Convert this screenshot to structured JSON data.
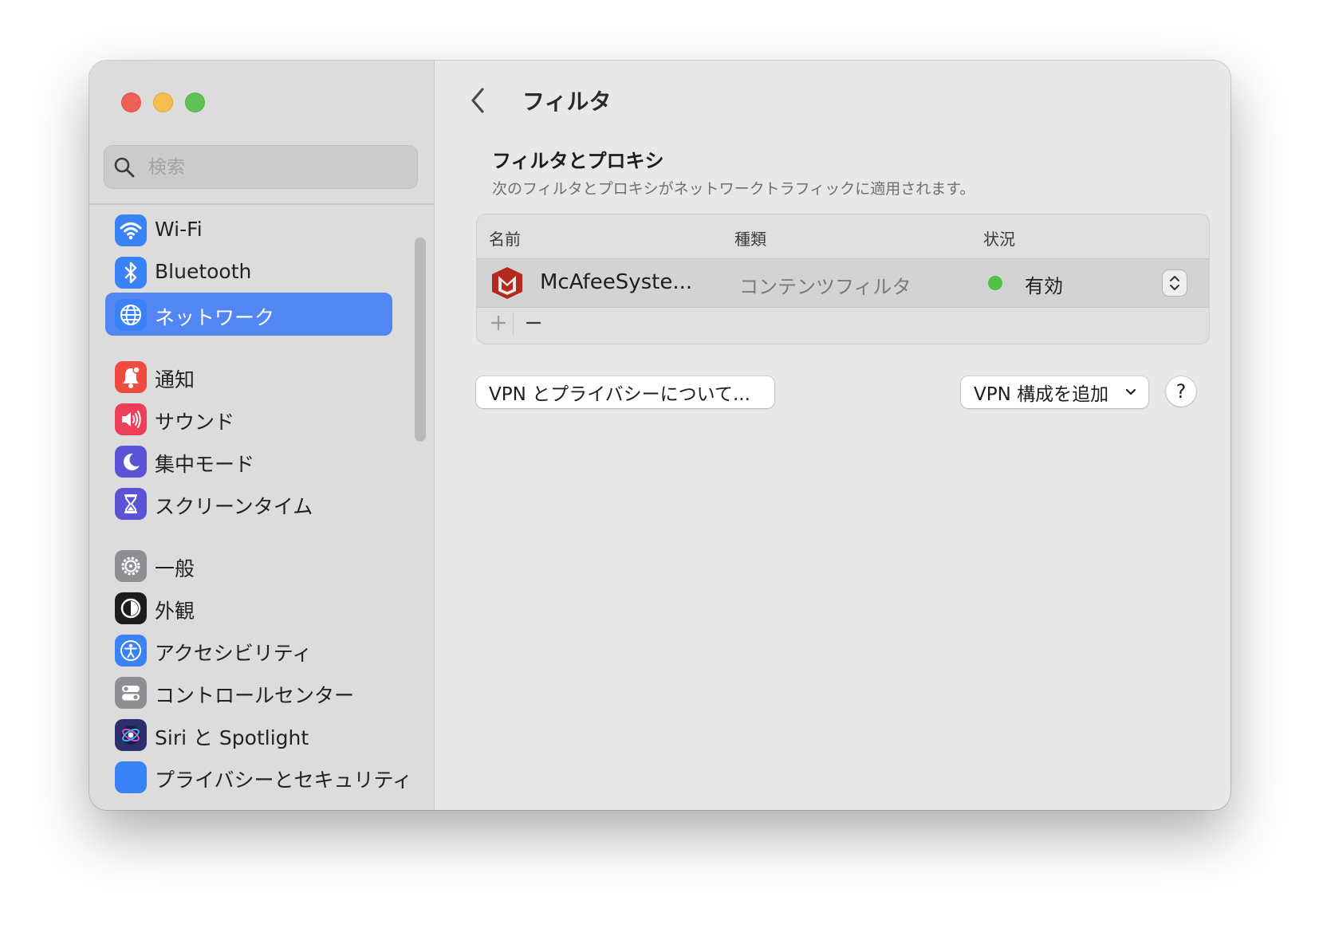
{
  "sidebar": {
    "search": {
      "placeholder": "検索"
    },
    "items": [
      {
        "label": "Wi-Fi",
        "icon": "wifi-icon",
        "color": "#3a82f7"
      },
      {
        "label": "Bluetooth",
        "icon": "bluetooth-icon",
        "color": "#3a82f7"
      },
      {
        "label": "ネットワーク",
        "icon": "globe-icon",
        "color": "#3a82f7",
        "selected": true
      },
      {
        "label": "通知",
        "icon": "bell-icon",
        "color": "#ef4b3f"
      },
      {
        "label": "サウンド",
        "icon": "speaker-icon",
        "color": "#ee3f5a"
      },
      {
        "label": "集中モード",
        "icon": "moon-icon",
        "color": "#5b53d6"
      },
      {
        "label": "スクリーンタイム",
        "icon": "hourglass-icon",
        "color": "#5b53d6"
      },
      {
        "label": "一般",
        "icon": "gear-icon",
        "color": "#8e8e93"
      },
      {
        "label": "外観",
        "icon": "appearance-icon",
        "color": "#1c1c1e"
      },
      {
        "label": "アクセシビリティ",
        "icon": "accessibility-icon",
        "color": "#3a82f7"
      },
      {
        "label": "コントロールセンター",
        "icon": "control-center-icon",
        "color": "#8e8e93"
      },
      {
        "label": "Siri と Spotlight",
        "icon": "siri-icon",
        "color": "#2b2f6e"
      },
      {
        "label": "プライバシーとセキュリティ",
        "icon": "privacy-hand-icon",
        "color": "#3a82f7"
      }
    ]
  },
  "header": {
    "title": "フィルタ"
  },
  "filters": {
    "title": "フィルタとプロキシ",
    "subtitle": "次のフィルタとプロキシがネットワークトラフィックに適用されます。",
    "columns": [
      "名前",
      "種類",
      "状況"
    ],
    "rows": [
      {
        "name": "McAfeeSyste...",
        "type": "コンテンツフィルタ",
        "status": "有効",
        "status_color": "#4fc244",
        "icon": "mcafee-logo-icon"
      }
    ]
  },
  "buttons": {
    "vpn_privacy": "VPN とプライバシーについて...",
    "add_vpn": "VPN 構成を追加",
    "help": "?"
  },
  "colors": {
    "accent": "#5286f2",
    "window_bg": "#e8e8e8",
    "sidebar_bg": "#dcdcdc"
  }
}
